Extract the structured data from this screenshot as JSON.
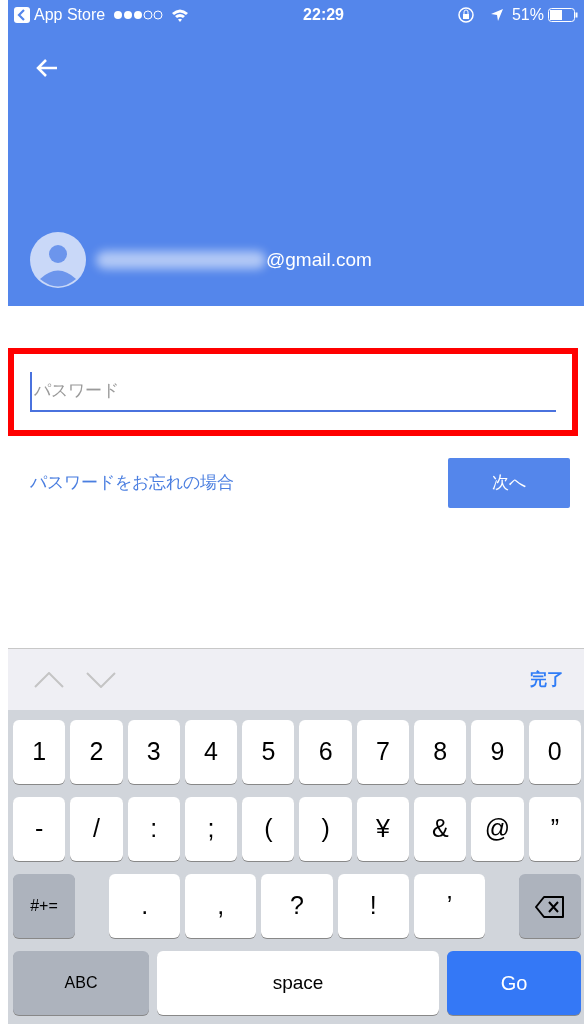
{
  "status_bar": {
    "back_app": "App Store",
    "time": "22:29",
    "battery": "51%"
  },
  "account": {
    "email_visible": "@gmail.com"
  },
  "password_field": {
    "placeholder": "パスワード",
    "focused": true,
    "highlighted": true
  },
  "forgot_link": "パスワードをお忘れの場合",
  "next_button": "次へ",
  "keyboard_toolbar": {
    "done": "完了"
  },
  "keyboard_rows": [
    [
      {
        "kind": "char",
        "label": "1"
      },
      {
        "kind": "char",
        "label": "2"
      },
      {
        "kind": "char",
        "label": "3"
      },
      {
        "kind": "char",
        "label": "4"
      },
      {
        "kind": "char",
        "label": "5"
      },
      {
        "kind": "char",
        "label": "6"
      },
      {
        "kind": "char",
        "label": "7"
      },
      {
        "kind": "char",
        "label": "8"
      },
      {
        "kind": "char",
        "label": "9"
      },
      {
        "kind": "char",
        "label": "0"
      }
    ],
    [
      {
        "kind": "char",
        "label": "-"
      },
      {
        "kind": "char",
        "label": "/"
      },
      {
        "kind": "char",
        "label": ":"
      },
      {
        "kind": "char",
        "label": ";"
      },
      {
        "kind": "char",
        "label": "("
      },
      {
        "kind": "char",
        "label": ")"
      },
      {
        "kind": "char",
        "label": "¥"
      },
      {
        "kind": "char",
        "label": "&"
      },
      {
        "kind": "char",
        "label": "@"
      },
      {
        "kind": "char",
        "label": "”"
      }
    ],
    [
      {
        "kind": "mode",
        "label": "#+="
      },
      {
        "kind": "char",
        "label": "."
      },
      {
        "kind": "char",
        "label": ","
      },
      {
        "kind": "char",
        "label": "?"
      },
      {
        "kind": "char",
        "label": "!"
      },
      {
        "kind": "char",
        "label": "’"
      },
      {
        "kind": "delete"
      }
    ],
    [
      {
        "kind": "abc",
        "label": "ABC"
      },
      {
        "kind": "space",
        "label": "space"
      },
      {
        "kind": "go",
        "label": "Go"
      }
    ]
  ]
}
